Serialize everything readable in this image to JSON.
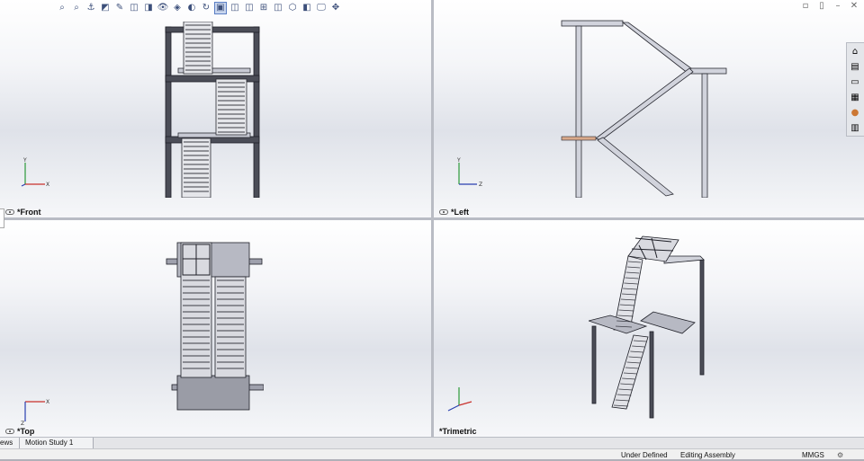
{
  "views": {
    "front": "*Front",
    "left": "*Left",
    "top": "*Top",
    "trimetric": "*Trimetric"
  },
  "axes": {
    "x": "X",
    "y": "Y",
    "z": "Z"
  },
  "hud_toolbar": [
    {
      "name": "zoom-to-fit-icon",
      "glyph": "⌕"
    },
    {
      "name": "zoom-to-area-icon",
      "glyph": "⌕"
    },
    {
      "name": "previous-view-icon",
      "glyph": "⚓"
    },
    {
      "name": "section-view-icon",
      "glyph": "◩"
    },
    {
      "name": "dynamic-annotation-icon",
      "glyph": "✎"
    },
    {
      "name": "view-orientation-icon",
      "glyph": "◫"
    },
    {
      "name": "display-style-icon",
      "glyph": "◨"
    },
    {
      "name": "hide-show-icon",
      "glyph": "👁"
    },
    {
      "name": "edit-appearance-icon",
      "glyph": "◈"
    },
    {
      "name": "apply-scene-icon",
      "glyph": "◐"
    },
    {
      "name": "rotate-view-icon",
      "glyph": "↻"
    },
    {
      "name": "single-view-icon",
      "glyph": "▣"
    },
    {
      "name": "two-view-horizontal-icon",
      "glyph": "◫"
    },
    {
      "name": "two-view-vertical-icon",
      "glyph": "◫"
    },
    {
      "name": "four-view-icon",
      "glyph": "⊞"
    },
    {
      "name": "link-views-icon",
      "glyph": "◫"
    },
    {
      "name": "isometric-icon",
      "glyph": "⬡"
    },
    {
      "name": "normal-to-icon",
      "glyph": "◧"
    },
    {
      "name": "view-settings-icon",
      "glyph": "🖵"
    },
    {
      "name": "move-icon",
      "glyph": "✥"
    }
  ],
  "tabs": {
    "views": "ews",
    "motion": "Motion Study 1"
  },
  "status": {
    "defined": "Under Defined",
    "editing": "Editing Assembly",
    "units": "MMGS",
    "gear": "⚙"
  },
  "colors": {
    "steel": "#3a3c45",
    "steel_light": "#c7c9d3",
    "accent": "#e6863a"
  }
}
